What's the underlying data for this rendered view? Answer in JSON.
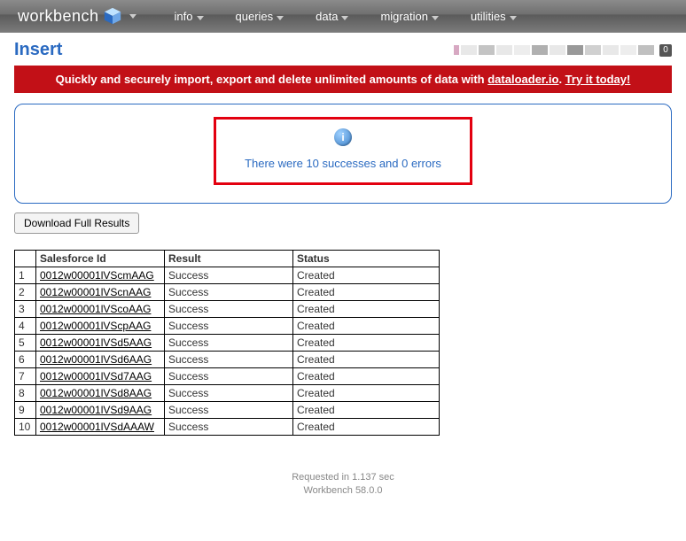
{
  "nav": {
    "brand": "workbench",
    "items": [
      "info",
      "queries",
      "data",
      "migration",
      "utilities"
    ]
  },
  "page_title": "Insert",
  "badge_count": "0",
  "banner": {
    "text_before": "Quickly and securely import, export and delete unlimited amounts of data with ",
    "link1": "dataloader.io",
    "mid": ". ",
    "link2": "Try it today!"
  },
  "info_message": "There were 10 successes and 0 errors",
  "download_button": "Download Full Results",
  "table": {
    "headers": {
      "id": "Salesforce Id",
      "result": "Result",
      "status": "Status"
    },
    "rows": [
      {
        "n": "1",
        "id": "0012w00001lVScmAAG",
        "result": "Success",
        "status": "Created"
      },
      {
        "n": "2",
        "id": "0012w00001lVScnAAG",
        "result": "Success",
        "status": "Created"
      },
      {
        "n": "3",
        "id": "0012w00001lVScoAAG",
        "result": "Success",
        "status": "Created"
      },
      {
        "n": "4",
        "id": "0012w00001lVScpAAG",
        "result": "Success",
        "status": "Created"
      },
      {
        "n": "5",
        "id": "0012w00001lVSd5AAG",
        "result": "Success",
        "status": "Created"
      },
      {
        "n": "6",
        "id": "0012w00001lVSd6AAG",
        "result": "Success",
        "status": "Created"
      },
      {
        "n": "7",
        "id": "0012w00001lVSd7AAG",
        "result": "Success",
        "status": "Created"
      },
      {
        "n": "8",
        "id": "0012w00001lVSd8AAG",
        "result": "Success",
        "status": "Created"
      },
      {
        "n": "9",
        "id": "0012w00001lVSd9AAG",
        "result": "Success",
        "status": "Created"
      },
      {
        "n": "10",
        "id": "0012w00001lVSdAAAW",
        "result": "Success",
        "status": "Created"
      }
    ]
  },
  "footer": {
    "line1": "Requested in 1.137 sec",
    "line2": "Workbench 58.0.0"
  }
}
